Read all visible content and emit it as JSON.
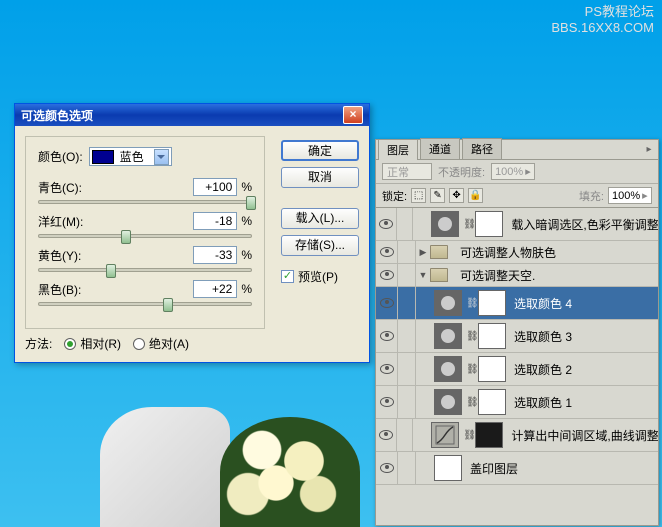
{
  "watermark": {
    "line1": "PS教程论坛",
    "line2": "BBS.16XX8.COM"
  },
  "dialog": {
    "title": "可选颜色选项",
    "colors_label": "颜色(O):",
    "selected_color": "蓝色",
    "sliders": [
      {
        "label": "青色(C):",
        "value": "+100",
        "pct": 100
      },
      {
        "label": "洋红(M):",
        "value": "-18",
        "pct": 41
      },
      {
        "label": "黄色(Y):",
        "value": "-33",
        "pct": 34
      },
      {
        "label": "黑色(B):",
        "value": "+22",
        "pct": 61
      }
    ],
    "percent": "%",
    "method_label": "方法:",
    "relative_label": "相对(R)",
    "absolute_label": "绝对(A)",
    "buttons": {
      "ok": "确定",
      "cancel": "取消",
      "load": "载入(L)...",
      "save": "存储(S)..."
    },
    "preview_label": "预览(P)"
  },
  "panel": {
    "tabs": [
      "图层",
      "通道",
      "路径"
    ],
    "blend_mode": "正常",
    "opacity_label": "不透明度:",
    "opacity_value": "100%",
    "lock_label": "锁定:",
    "fill_label": "填充:",
    "fill_value": "100%",
    "layers": [
      {
        "type": "adj",
        "name": "载入暗调选区,色彩平衡调整...",
        "indent": 1
      },
      {
        "type": "folder",
        "name": "可选调整人物肤色",
        "open": false,
        "indent": 0
      },
      {
        "type": "folder",
        "name": "可选调整天空.",
        "open": true,
        "indent": 0
      },
      {
        "type": "adj",
        "name": "选取颜色 4",
        "indent": 1,
        "selected": true
      },
      {
        "type": "adj",
        "name": "选取颜色 3",
        "indent": 1
      },
      {
        "type": "adj",
        "name": "选取颜色 2",
        "indent": 1
      },
      {
        "type": "adj",
        "name": "选取颜色 1",
        "indent": 1
      },
      {
        "type": "curves",
        "name": "计算出中间调区域,曲线调整...",
        "indent": 1
      },
      {
        "type": "img",
        "name": "盖印图层",
        "indent": 1
      }
    ]
  }
}
